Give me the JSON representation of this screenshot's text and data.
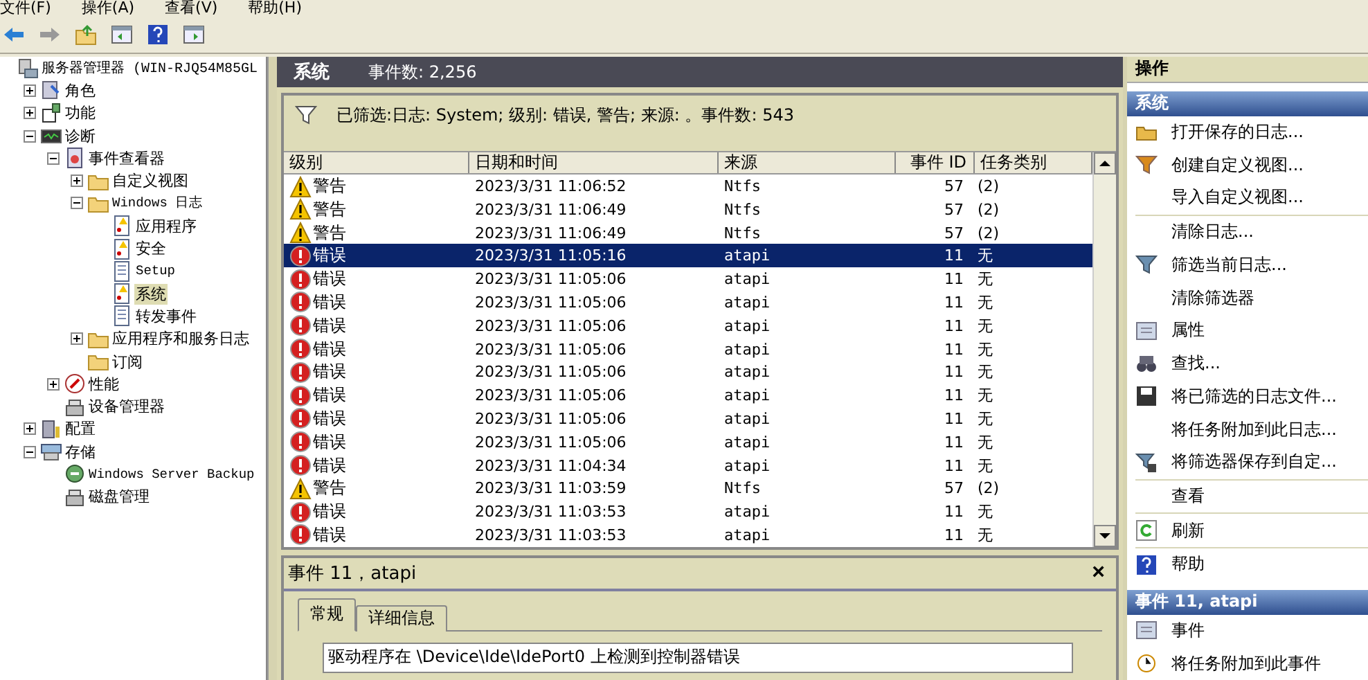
{
  "menu": [
    {
      "label": "文件(F)"
    },
    {
      "label": "操作(A)"
    },
    {
      "label": "查看(V)"
    },
    {
      "label": "帮助(H)"
    }
  ],
  "toolbar": [
    {
      "kind": "back"
    },
    {
      "kind": "forward"
    },
    {
      "kind": "up"
    },
    {
      "kind": "pane-left"
    },
    {
      "kind": "help"
    },
    {
      "kind": "pane-right"
    }
  ],
  "tree": [
    {
      "label": "服务器管理器 (WIN-RJQ54M85GL",
      "kind": "server",
      "selected": false,
      "children": [
        {
          "label": "角色",
          "kind": "roles",
          "expanded": false,
          "selected": false
        },
        {
          "label": "功能",
          "kind": "features",
          "expanded": false,
          "selected": false
        },
        {
          "label": "诊断",
          "kind": "diag",
          "expanded": true,
          "selected": false,
          "children": [
            {
              "label": "事件查看器",
              "kind": "viewer",
              "expanded": true,
              "selected": false,
              "children": [
                {
                  "label": "自定义视图",
                  "kind": "folder",
                  "expanded": false,
                  "selected": false
                },
                {
                  "label": "Windows 日志",
                  "kind": "folder",
                  "expanded": true,
                  "selected": false,
                  "children": [
                    {
                      "label": "应用程序",
                      "kind": "log-alert",
                      "selected": false
                    },
                    {
                      "label": "安全",
                      "kind": "log-alert",
                      "selected": false
                    },
                    {
                      "label": "Setup",
                      "kind": "log",
                      "selected": false
                    },
                    {
                      "label": "系统",
                      "kind": "log-alert",
                      "selected": true
                    },
                    {
                      "label": "转发事件",
                      "kind": "log",
                      "selected": false
                    }
                  ]
                },
                {
                  "label": "应用程序和服务日志",
                  "kind": "folder",
                  "expanded": false,
                  "selected": false
                },
                {
                  "label": "订阅",
                  "kind": "folder",
                  "selected": false
                }
              ]
            },
            {
              "label": "性能",
              "kind": "perf",
              "expanded": false,
              "selected": false
            },
            {
              "label": "设备管理器",
              "kind": "device",
              "selected": false
            }
          ]
        },
        {
          "label": "配置",
          "kind": "config",
          "expanded": false,
          "selected": false
        },
        {
          "label": "存储",
          "kind": "storage",
          "expanded": true,
          "selected": false,
          "children": [
            {
              "label": "Windows Server Backup",
              "kind": "backup",
              "selected": false
            },
            {
              "label": "磁盘管理",
              "kind": "device",
              "selected": false
            }
          ]
        }
      ]
    }
  ],
  "log_header": {
    "title": "系统",
    "count": "事件数: 2,256"
  },
  "filter_text": "已筛选:日志: System; 级别: 错误, 警告; 来源: 。事件数: 543",
  "table": {
    "columns": [
      "级别",
      "日期和时间",
      "来源",
      "事件 ID",
      "任务类别"
    ],
    "rows": [
      {
        "kind": "warning",
        "level": "警告",
        "time": "2023/3/31 11:06:52",
        "source": "Ntfs",
        "id": "57",
        "task": "(2)",
        "selected": false
      },
      {
        "kind": "warning",
        "level": "警告",
        "time": "2023/3/31 11:06:49",
        "source": "Ntfs",
        "id": "57",
        "task": "(2)",
        "selected": false
      },
      {
        "kind": "warning",
        "level": "警告",
        "time": "2023/3/31 11:06:49",
        "source": "Ntfs",
        "id": "57",
        "task": "(2)",
        "selected": false
      },
      {
        "kind": "error",
        "level": "错误",
        "time": "2023/3/31 11:05:16",
        "source": "atapi",
        "id": "11",
        "task": "无",
        "selected": true
      },
      {
        "kind": "error",
        "level": "错误",
        "time": "2023/3/31 11:05:06",
        "source": "atapi",
        "id": "11",
        "task": "无",
        "selected": false
      },
      {
        "kind": "error",
        "level": "错误",
        "time": "2023/3/31 11:05:06",
        "source": "atapi",
        "id": "11",
        "task": "无",
        "selected": false
      },
      {
        "kind": "error",
        "level": "错误",
        "time": "2023/3/31 11:05:06",
        "source": "atapi",
        "id": "11",
        "task": "无",
        "selected": false
      },
      {
        "kind": "error",
        "level": "错误",
        "time": "2023/3/31 11:05:06",
        "source": "atapi",
        "id": "11",
        "task": "无",
        "selected": false
      },
      {
        "kind": "error",
        "level": "错误",
        "time": "2023/3/31 11:05:06",
        "source": "atapi",
        "id": "11",
        "task": "无",
        "selected": false
      },
      {
        "kind": "error",
        "level": "错误",
        "time": "2023/3/31 11:05:06",
        "source": "atapi",
        "id": "11",
        "task": "无",
        "selected": false
      },
      {
        "kind": "error",
        "level": "错误",
        "time": "2023/3/31 11:05:06",
        "source": "atapi",
        "id": "11",
        "task": "无",
        "selected": false
      },
      {
        "kind": "error",
        "level": "错误",
        "time": "2023/3/31 11:05:06",
        "source": "atapi",
        "id": "11",
        "task": "无",
        "selected": false
      },
      {
        "kind": "error",
        "level": "错误",
        "time": "2023/3/31 11:04:34",
        "source": "atapi",
        "id": "11",
        "task": "无",
        "selected": false
      },
      {
        "kind": "warning",
        "level": "警告",
        "time": "2023/3/31 11:03:59",
        "source": "Ntfs",
        "id": "57",
        "task": "(2)",
        "selected": false
      },
      {
        "kind": "error",
        "level": "错误",
        "time": "2023/3/31 11:03:53",
        "source": "atapi",
        "id": "11",
        "task": "无",
        "selected": false
      },
      {
        "kind": "error",
        "level": "错误",
        "time": "2023/3/31 11:03:53",
        "source": "atapi",
        "id": "11",
        "task": "无",
        "selected": false
      }
    ]
  },
  "detail": {
    "title": "事件 11，atapi",
    "close": "×",
    "tabs": [
      {
        "label": "常规",
        "selected": true
      },
      {
        "label": "详细信息",
        "selected": false
      }
    ],
    "description": "驱动程序在 \\Device\\Ide\\IdePort0 上检测到控制器错误"
  },
  "actions": {
    "title": "操作",
    "sections": [
      {
        "title": "系统",
        "items": [
          {
            "kind": "open",
            "label": "打开保存的日志..."
          },
          {
            "kind": "funnel",
            "label": "创建自定义视图..."
          },
          {
            "kind": "plain",
            "label": "导入自定义视图..."
          },
          {
            "kind": "separator"
          },
          {
            "kind": "plain",
            "label": "清除日志..."
          },
          {
            "kind": "funnel-blue",
            "label": "筛选当前日志..."
          },
          {
            "kind": "plain",
            "label": "清除筛选器"
          },
          {
            "kind": "props",
            "label": "属性"
          },
          {
            "kind": "find",
            "label": "查找..."
          },
          {
            "kind": "save",
            "label": "将已筛选的日志文件..."
          },
          {
            "kind": "plain",
            "label": "将任务附加到此日志..."
          },
          {
            "kind": "funnel-save",
            "label": "将筛选器保存到自定..."
          },
          {
            "kind": "separator"
          },
          {
            "kind": "plain",
            "label": "查看"
          },
          {
            "kind": "separator"
          },
          {
            "kind": "refresh",
            "label": "刷新"
          },
          {
            "kind": "separator"
          },
          {
            "kind": "help",
            "label": "帮助"
          }
        ]
      },
      {
        "title": "事件 11, atapi",
        "items": [
          {
            "kind": "props",
            "label": "事件"
          },
          {
            "kind": "task",
            "label": "将任务附加到此事件"
          }
        ]
      }
    ]
  }
}
